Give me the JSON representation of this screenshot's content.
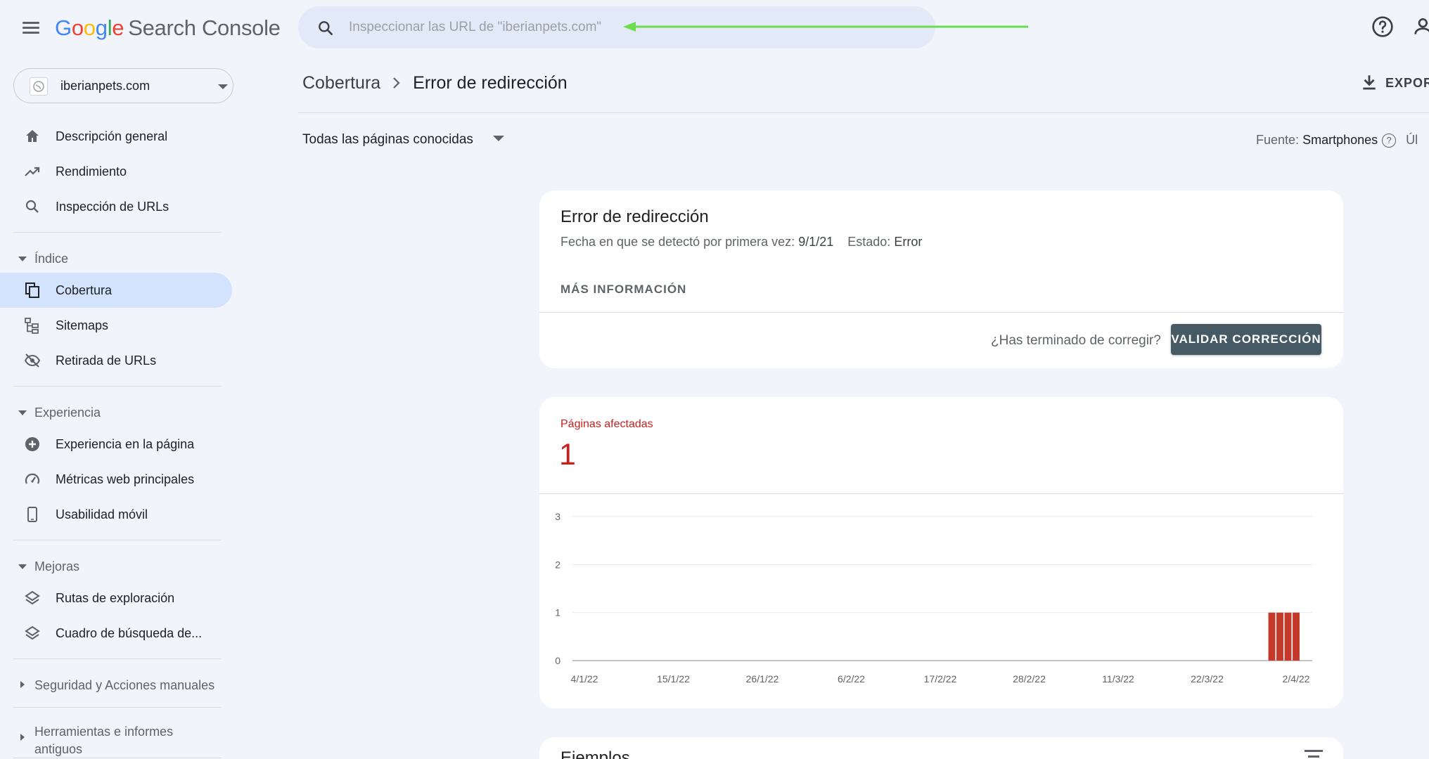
{
  "header": {
    "logo": {
      "G": "G",
      "o1": "o",
      "o2": "o",
      "g": "g",
      "l": "l",
      "e": "e",
      "product": "Search Console"
    },
    "search_placeholder": "Inspeccionar las URL de \"iberianpets.com\"",
    "arrow_color": "#6ddc4f"
  },
  "sidebar": {
    "property": "iberianpets.com",
    "items_top": [
      {
        "label": "Descripción general",
        "icon": "home-icon"
      },
      {
        "label": "Rendimiento",
        "icon": "trending-up-icon"
      },
      {
        "label": "Inspección de URLs",
        "icon": "search-icon"
      }
    ],
    "sections": [
      {
        "label": "Índice",
        "expanded": true,
        "items": [
          {
            "label": "Cobertura",
            "icon": "file-copy-icon",
            "active": true
          },
          {
            "label": "Sitemaps",
            "icon": "sitemap-icon"
          },
          {
            "label": "Retirada de URLs",
            "icon": "eye-off-icon"
          }
        ]
      },
      {
        "label": "Experiencia",
        "expanded": true,
        "items": [
          {
            "label": "Experiencia en la página",
            "icon": "plus-circle-icon"
          },
          {
            "label": "Métricas web principales",
            "icon": "speedometer-icon"
          },
          {
            "label": "Usabilidad móvil",
            "icon": "smartphone-icon"
          }
        ]
      },
      {
        "label": "Mejoras",
        "expanded": true,
        "items": [
          {
            "label": "Rutas de exploración",
            "icon": "layers-icon"
          },
          {
            "label": "Cuadro de búsqueda de...",
            "icon": "layers-icon"
          }
        ]
      },
      {
        "label": "Seguridad y Acciones manuales",
        "expanded": false
      },
      {
        "label": "Herramientas e informes antiguos",
        "expanded": false
      }
    ]
  },
  "main": {
    "breadcrumb_parent": "Cobertura",
    "breadcrumb_current": "Error de redirección",
    "export_label": "EXPOR",
    "filter_label": "Todas las páginas conocidas",
    "source_label": "Fuente:",
    "source_value": "Smartphones",
    "source_help": "?",
    "cutoff_text": "Úl"
  },
  "issue_card": {
    "title": "Error de redirección",
    "first_detected_label": "Fecha en que se detectó por primera vez:",
    "first_detected_value": "9/1/21",
    "status_label": "Estado:",
    "status_value": "Error",
    "more_info": "MÁS INFORMACIÓN",
    "done_question": "¿Has terminado de corregir?",
    "validate_button": "VALIDAR CORRECCIÓN",
    "button_color": "#455a64"
  },
  "affected_card": {
    "label": "Páginas afectadas",
    "value": "1",
    "color": "#c5221f"
  },
  "chart_data": {
    "type": "bar",
    "ylim": [
      0,
      3
    ],
    "y_ticks": [
      "0",
      "1",
      "2",
      "3"
    ],
    "x_tick_labels": [
      "4/1/22",
      "15/1/22",
      "26/1/22",
      "6/2/22",
      "17/2/22",
      "28/2/22",
      "11/3/22",
      "22/3/22",
      "2/4/22"
    ],
    "x_tick_day_index": [
      0,
      11,
      22,
      33,
      44,
      55,
      66,
      77,
      88
    ],
    "total_days": 92,
    "series": [
      {
        "values_by_day_index": [
          [
            85,
            1
          ],
          [
            86,
            1
          ],
          [
            87,
            1
          ],
          [
            88,
            1
          ]
        ]
      }
    ],
    "bar_color": "#c5392b",
    "grid": true
  },
  "examples_card": {
    "title": "Ejemplos"
  }
}
